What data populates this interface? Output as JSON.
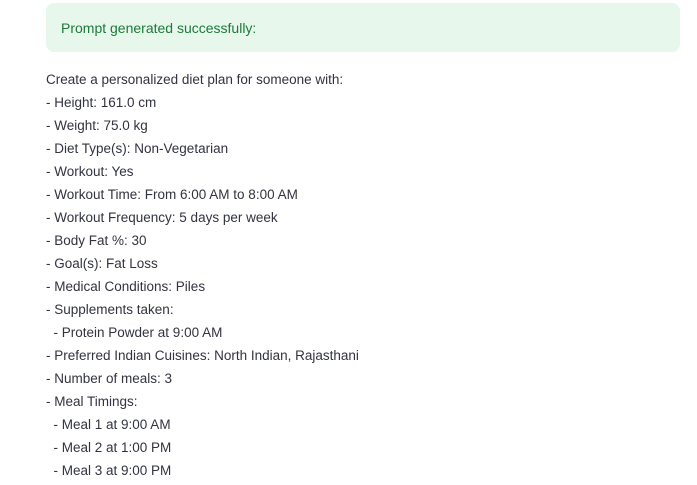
{
  "alert": {
    "message": "Prompt generated successfully:"
  },
  "prompt": {
    "lines": [
      "Create a personalized diet plan for someone with:",
      "- Height: 161.0 cm",
      "- Weight: 75.0 kg",
      "- Diet Type(s): Non-Vegetarian",
      "- Workout: Yes",
      "- Workout Time: From 6:00 AM to 8:00 AM",
      "- Workout Frequency: 5 days per week",
      "- Body Fat %: 30",
      "- Goal(s): Fat Loss",
      "- Medical Conditions: Piles",
      "- Supplements taken:",
      "  - Protein Powder at 9:00 AM",
      "- Preferred Indian Cuisines: North Indian, Rajasthani",
      "- Number of meals: 3",
      "- Meal Timings:",
      "  - Meal 1 at 9:00 AM",
      "  - Meal 2 at 1:00 PM",
      "  - Meal 3 at 9:00 PM"
    ]
  },
  "colors": {
    "alert_background": "#e8f7ec",
    "alert_text": "#1b7a3a",
    "body_text": "#31333f"
  }
}
